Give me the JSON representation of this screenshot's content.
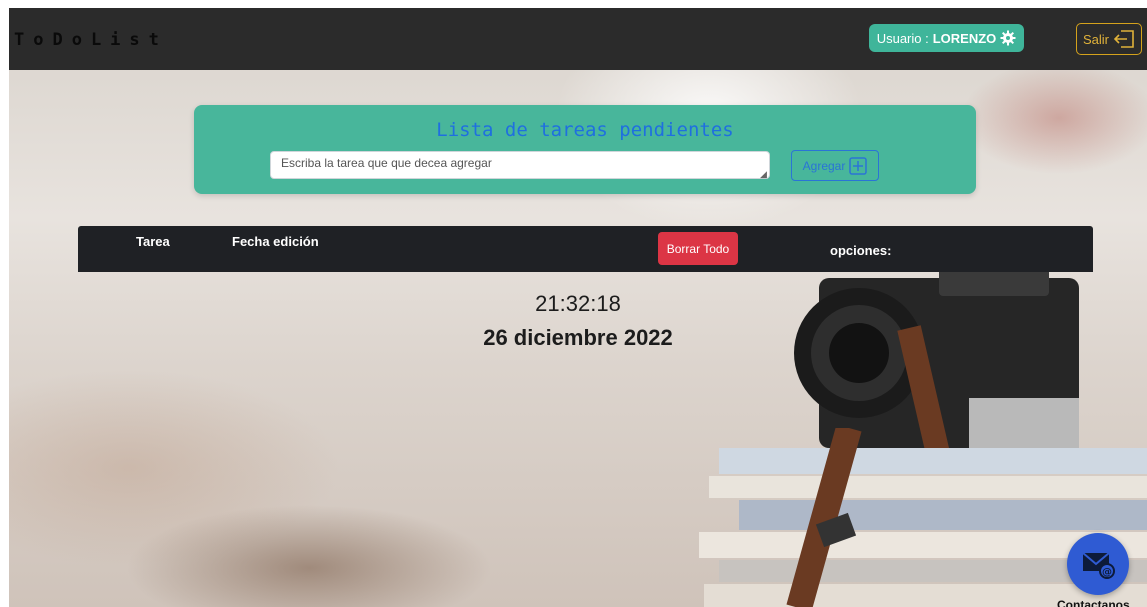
{
  "navbar": {
    "brand": "ToDoList",
    "user_prefix": "Usuario :",
    "user_name": "LORENZO",
    "logout_label": "Salir"
  },
  "task_form": {
    "title": "Lista de tareas pendientes",
    "input_placeholder": "Escriba la tarea que que decea agregar",
    "input_value": "",
    "add_label": "Agregar"
  },
  "table": {
    "headers": {
      "task": "Tarea",
      "edit_date": "Fecha edición",
      "options": "opciones:"
    },
    "delete_all_label": "Borrar Todo"
  },
  "clock": {
    "time": "21:32:18",
    "date": "26 diciembre 2022"
  },
  "contact": {
    "label": "Contactanos"
  },
  "colors": {
    "navbar_bg": "#2b2b2b",
    "user_badge": "#3fb59a",
    "logout_border": "#d4a21c",
    "card_bg": "#48b69b",
    "card_title": "#1f6fe0",
    "add_button": "#2a74d6",
    "table_header_bg": "#1f2125",
    "delete_all": "#dc3545",
    "contact_fab": "#2f5bd3"
  },
  "icons": {
    "user_settings": "gear-icon",
    "logout": "logout-arrow-icon",
    "add": "plus-square-icon",
    "contact": "envelope-at-icon"
  }
}
